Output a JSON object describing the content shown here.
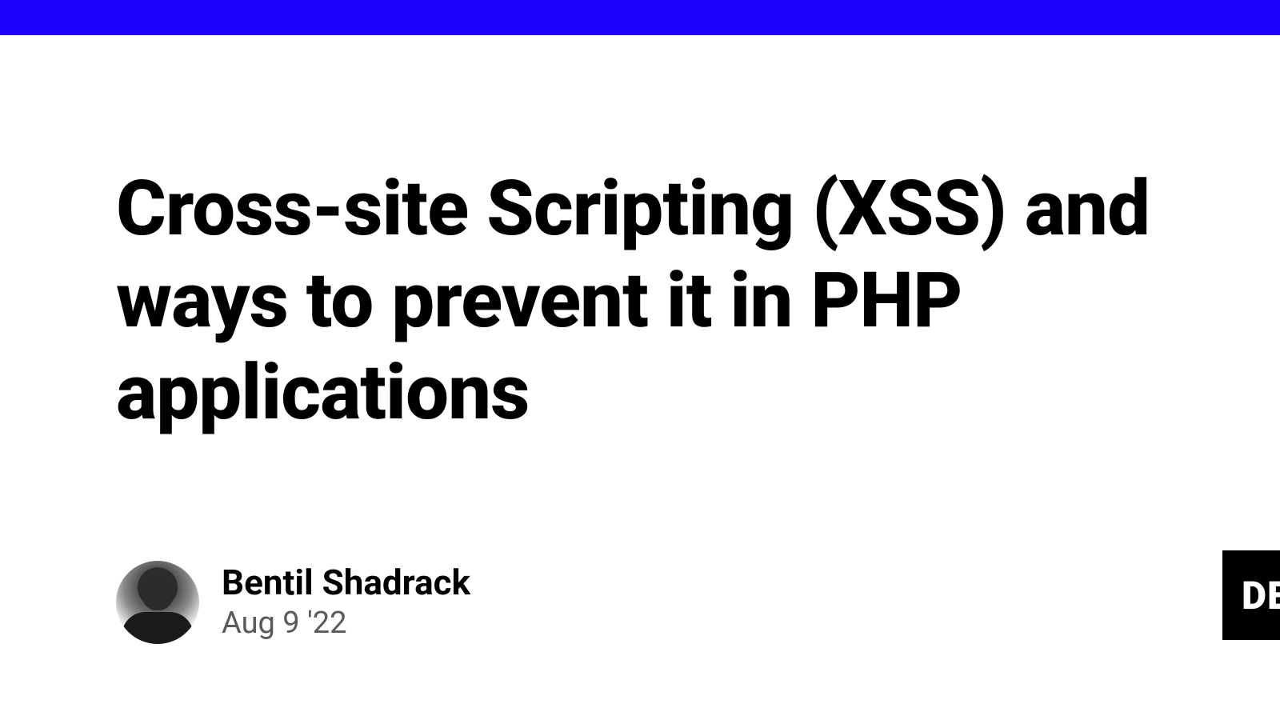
{
  "header": {
    "bar_color": "#1e00ff"
  },
  "article": {
    "title": "Cross-site Scripting (XSS) and ways to prevent it in PHP applications"
  },
  "author": {
    "name": "Bentil Shadrack",
    "date": "Aug 9 '22"
  },
  "badge": {
    "text": "DE"
  }
}
